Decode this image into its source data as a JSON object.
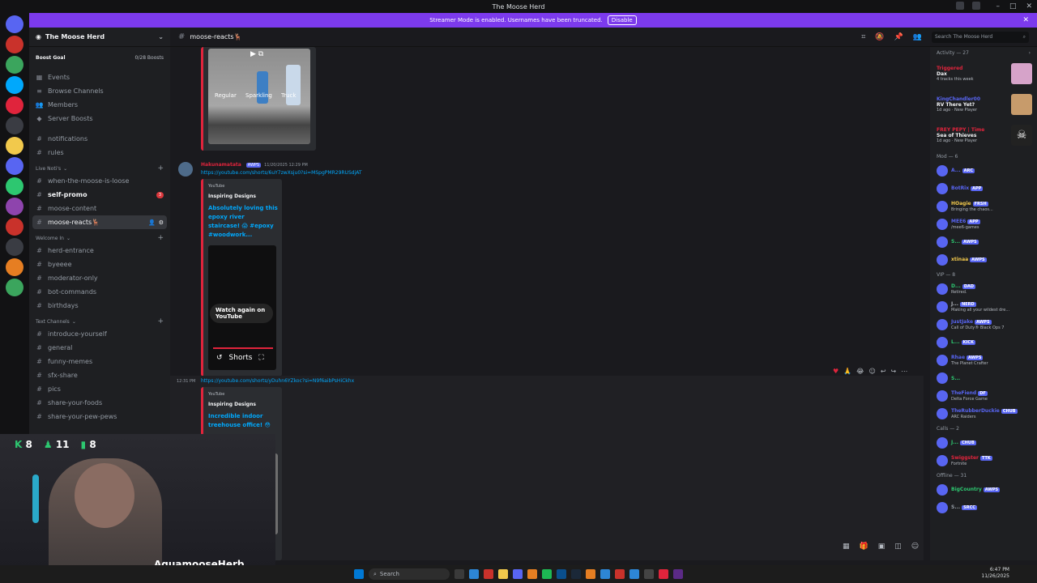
{
  "window": {
    "title": "The Moose Herd"
  },
  "banner": {
    "text": "Streamer Mode is enabled. Usernames have been truncated.",
    "disable_label": "Disable"
  },
  "server": {
    "name": "The Moose Herd",
    "boost_goal": "Boost Goal",
    "boost_count": "0/28 Boosts"
  },
  "sidebar": {
    "top_items": [
      {
        "label": "Events"
      },
      {
        "label": "Browse Channels"
      },
      {
        "label": "Members"
      },
      {
        "label": "Server Boosts"
      }
    ],
    "general_channels": [
      {
        "label": "notifications"
      },
      {
        "label": "rules"
      }
    ],
    "live_category": "Live Noti's",
    "live_channels": [
      {
        "label": "when-the-moose-is-loose"
      },
      {
        "label": "self-promo",
        "badge": "3"
      },
      {
        "label": "moose-content"
      },
      {
        "label": "moose-reacts🦌"
      }
    ],
    "welcome_category": "Welcome In",
    "welcome_channels": [
      {
        "label": "herd-entrance"
      },
      {
        "label": "byeeee"
      },
      {
        "label": "moderator-only"
      },
      {
        "label": "bot-commands"
      },
      {
        "label": "birthdays"
      }
    ],
    "text_category": "Text Channels",
    "text_channels": [
      {
        "label": "introduce-yourself"
      },
      {
        "label": "general"
      },
      {
        "label": "funny-memes"
      },
      {
        "label": "sfx-share"
      },
      {
        "label": "pics"
      },
      {
        "label": "share-your-foods"
      },
      {
        "label": "share-your-pew-pews"
      }
    ]
  },
  "channel": {
    "name": "moose-reacts🦌",
    "search_placeholder": "Search The Moose Herd"
  },
  "messages": {
    "first_embed_labels": [
      "Regular",
      "Sparkling",
      "Truck"
    ],
    "msg2": {
      "author": "Hakunamatata",
      "tag": "AWPS",
      "timestamp": "11/20/2025 12:29 PM",
      "link": "https://youtube.com/shorts/6uY7zwXsju0?si=MSpgPMR29RUSdjAT",
      "provider": "YouTube",
      "embed_author": "Inspiring Designs",
      "embed_title": "Absolutely loving this epoxy river staircase! 😱 #epoxy #woodwork...",
      "watch_again": "Watch again on YouTube",
      "shorts_label": "Shorts"
    },
    "msg3": {
      "time": "12:31 PM",
      "link": "https://youtube.com/shorts/yDuhn6YZkoc?si=N9f6aibPsHiCkhx",
      "provider": "YouTube",
      "embed_author": "Inspiring Designs",
      "embed_title": "Incredible indoor treehouse office! 😳"
    }
  },
  "members": {
    "activity_header": "Activity — 27",
    "activities": [
      {
        "name": "Triggered",
        "game": "Dax",
        "sub": "4 tracks this week"
      },
      {
        "name": "KingChandler00",
        "game": "RV There Yet?",
        "sub": "1d ago · New Player"
      },
      {
        "name": "FREY PEPY | Time",
        "game": "Sea of Thieves",
        "sub": "1d ago · New Player"
      }
    ],
    "mod_header": "Mod — 6",
    "mods": [
      {
        "name": "A...",
        "tag": "ARC",
        "color": "#5865f2",
        "sub": ""
      },
      {
        "name": "BotRix",
        "tag": "APP",
        "color": "#5865f2",
        "sub": ""
      },
      {
        "name": "HOagie",
        "tag": "FRSH",
        "color": "#f2c94c",
        "sub": "Bringing the chaos..."
      },
      {
        "name": "MEE6",
        "tag": "APP",
        "color": "#5865f2",
        "sub": "/mee6-games"
      },
      {
        "name": "S...",
        "tag": "AWPS",
        "color": "#2dc770",
        "sub": ""
      },
      {
        "name": "xtinaa",
        "tag": "AWPS",
        "color": "#f2c94c",
        "sub": ""
      }
    ],
    "vip_header": "VIP — 8",
    "vips": [
      {
        "name": "D...",
        "tag": "DAD",
        "color": "#2dc770",
        "sub": "Retired."
      },
      {
        "name": "J...",
        "tag": "NERD",
        "color": "#b5bac1",
        "sub": "Making all your wildest dre..."
      },
      {
        "name": "JustJake",
        "tag": "AWPS",
        "color": "#5865f2",
        "sub": "Call of Duty® Black Ops 7"
      },
      {
        "name": "L...",
        "tag": "KICK",
        "color": "#2dc770",
        "sub": ""
      },
      {
        "name": "Rhae",
        "tag": "AWPS",
        "color": "#5865f2",
        "sub": "The Planet Crafter"
      },
      {
        "name": "S...",
        "tag": "",
        "color": "#2dc770",
        "sub": ""
      },
      {
        "name": "TheFiend",
        "tag": "DF",
        "color": "#5865f2",
        "sub": "Delta Force Game"
      },
      {
        "name": "TheRubberDuckie",
        "tag": "CHUB",
        "color": "#5865f2",
        "sub": "ARC Raiders"
      }
    ],
    "calls_header": "Calls — 2",
    "calls": [
      {
        "name": "J...",
        "tag": "CHUB",
        "color": "#2dc770",
        "sub": ""
      },
      {
        "name": "Swiggster",
        "tag": "TTK",
        "color": "#e0243c",
        "sub": "Fortnite"
      }
    ],
    "offline_header": "Offline — 31",
    "offline": [
      {
        "name": "BigCountry",
        "tag": "AWPS",
        "color": "#2dc770",
        "sub": ""
      },
      {
        "name": "S...",
        "tag": "SRCC",
        "color": "#949ba4",
        "sub": ""
      }
    ]
  },
  "webcam": {
    "stat1": "8",
    "stat2": "11",
    "stat3": "8",
    "streamer": "AquamooseHerb"
  },
  "taskbar": {
    "search": "Search",
    "time": "6:47 PM",
    "date": "11/26/2025"
  }
}
